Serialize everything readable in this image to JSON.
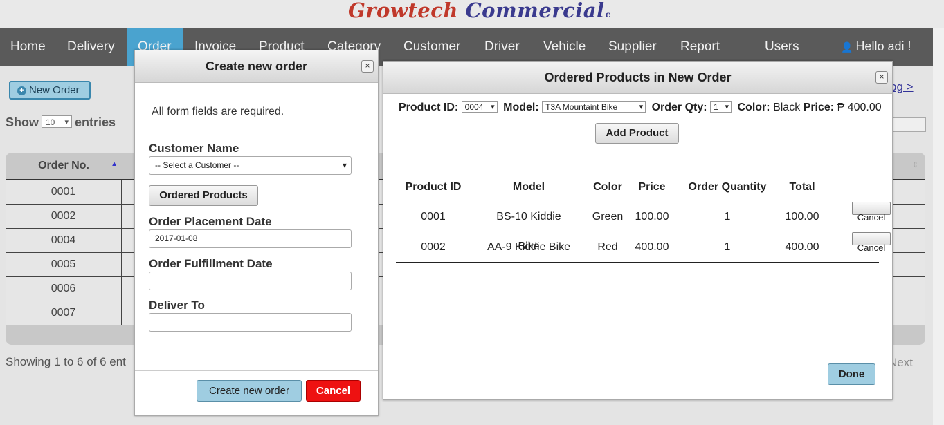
{
  "brand": {
    "part1": "Growtech",
    "part2": "Commercial",
    "suffix": "c"
  },
  "nav": {
    "items": [
      "Home",
      "Delivery",
      "Order",
      "Invoice",
      "Product",
      "Category",
      "Customer",
      "Driver",
      "Vehicle",
      "Supplier",
      "Report",
      "Users"
    ],
    "active": "Order",
    "greeting": "Hello adi !"
  },
  "page": {
    "new_order_label": "New Order",
    "show_label": "Show",
    "entries_value": "10",
    "entries_label": "entries",
    "link_partial": "og >",
    "table": {
      "column_order_no": "Order No.",
      "orders": [
        "0001",
        "0002",
        "0004",
        "0005",
        "0006",
        "0007"
      ]
    },
    "showing_text": "Showing 1 to 6 of 6 ent",
    "next_label": "Next"
  },
  "create_dialog": {
    "title": "Create new order",
    "close_label": "×",
    "note": "All form fields are required.",
    "customer_label": "Customer Name",
    "customer_value": "-- Select a Customer --",
    "ordered_products_btn": "Ordered Products",
    "placement_label": "Order Placement Date",
    "placement_value": "2017-01-08",
    "fulfillment_label": "Order Fulfillment Date",
    "fulfillment_value": "",
    "deliver_label": "Deliver To",
    "deliver_value": "",
    "submit_label": "Create new order",
    "cancel_label": "Cancel"
  },
  "products_dialog": {
    "title": "Ordered Products in New Order",
    "close_label": "×",
    "product_id_label": "Product ID:",
    "product_id_value": "0004",
    "model_label": "Model:",
    "model_value": "T3A Mountaint Bike",
    "qty_label": "Order Qty:",
    "qty_value": "1",
    "color_label": "Color:",
    "color_value": "Black",
    "price_label": "Price:",
    "price_value": "₱ 400.00",
    "add_label": "Add Product",
    "columns": [
      "Product ID",
      "Model",
      "Color",
      "Price",
      "Order Quantity",
      "Total"
    ],
    "rows": [
      {
        "id": "0001",
        "model": "BS-10 Kiddie Bike",
        "color": "Green",
        "price": "100.00",
        "qty": "1",
        "total": "100.00",
        "action": "Cancel"
      },
      {
        "id": "0002",
        "model": "AA-9 Kiddie Bike",
        "color": "Red",
        "price": "400.00",
        "qty": "1",
        "total": "400.00",
        "action": "Cancel"
      }
    ],
    "done_label": "Done"
  },
  "colors": {
    "accent": "#4aa3cf",
    "nav_bg": "#5a5a5a",
    "danger": "#ee1111",
    "button_blue": "#9fcde1"
  }
}
